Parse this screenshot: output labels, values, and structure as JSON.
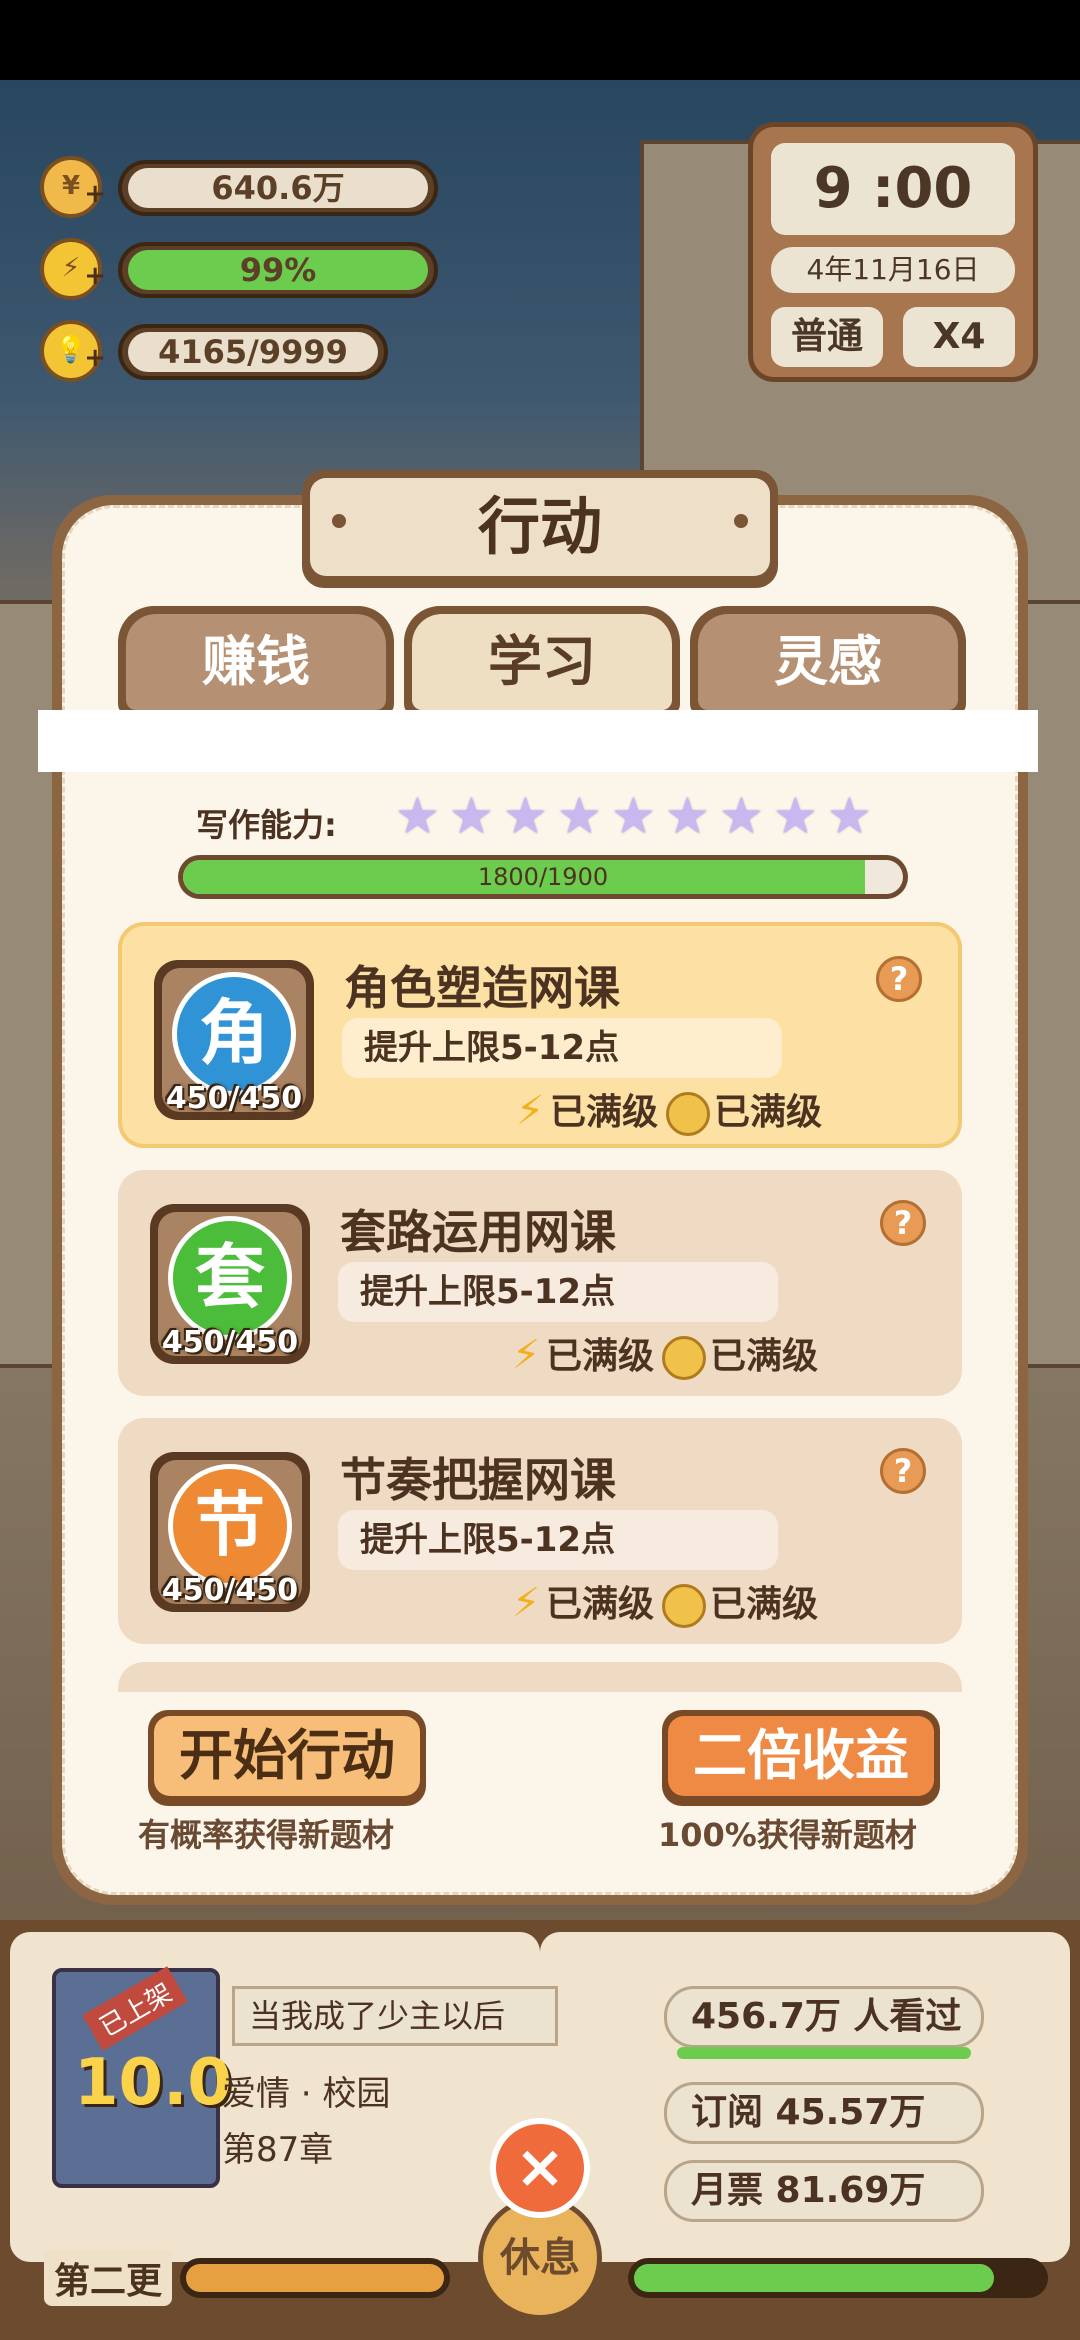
{
  "resources": {
    "coins": "640.6万",
    "energy": "99%",
    "inspiration": "4165/9999"
  },
  "clock": {
    "time": "9 :00",
    "date": "4年11月16日",
    "speed_mode": "普通",
    "speed_multiplier": "X4"
  },
  "modal": {
    "title": "行动",
    "tabs": [
      {
        "label": "赚钱",
        "active": false
      },
      {
        "label": "学习",
        "active": true
      },
      {
        "label": "灵感",
        "active": false
      }
    ],
    "skill_label": "写作能力:",
    "skill_stars": 9,
    "skill_progress": {
      "text": "1800/1900",
      "current": 1800,
      "max": 1900
    },
    "courses": [
      {
        "char": "角",
        "name": "角色塑造网课",
        "count": "450/450",
        "desc": "提升上限5-12点",
        "energy_status": "已满级",
        "coin_status": "已满级",
        "color": "#2f93d6",
        "help": "?"
      },
      {
        "char": "套",
        "name": "套路运用网课",
        "count": "450/450",
        "desc": "提升上限5-12点",
        "energy_status": "已满级",
        "coin_status": "已满级",
        "color": "#4cbd3a",
        "help": "?"
      },
      {
        "char": "节",
        "name": "节奏把握网课",
        "count": "450/450",
        "desc": "提升上限5-12点",
        "energy_status": "已满级",
        "coin_status": "已满级",
        "color": "#ee8a34",
        "help": "?"
      }
    ],
    "start_button": "开始行动",
    "start_sub": "有概率获得新题材",
    "double_button": "二倍收益",
    "double_sub": "100%获得新题材"
  },
  "novel": {
    "tag": "已上架",
    "score": "10.0",
    "title": "当我成了少主以后",
    "genre": "爱情 · 校园",
    "chapter": "第87章",
    "views": "456.7万 人看过",
    "subscriptions": "订阅  45.57万",
    "monthly_tickets": "月票  81.69万"
  },
  "bottom": {
    "close_icon": "×",
    "rest_label": "休息",
    "update_label": "第二更"
  },
  "colors": {
    "accent_orange": "#ef8a45",
    "progress_green": "#6ccc4e",
    "frame_brown": "#8c6542"
  }
}
